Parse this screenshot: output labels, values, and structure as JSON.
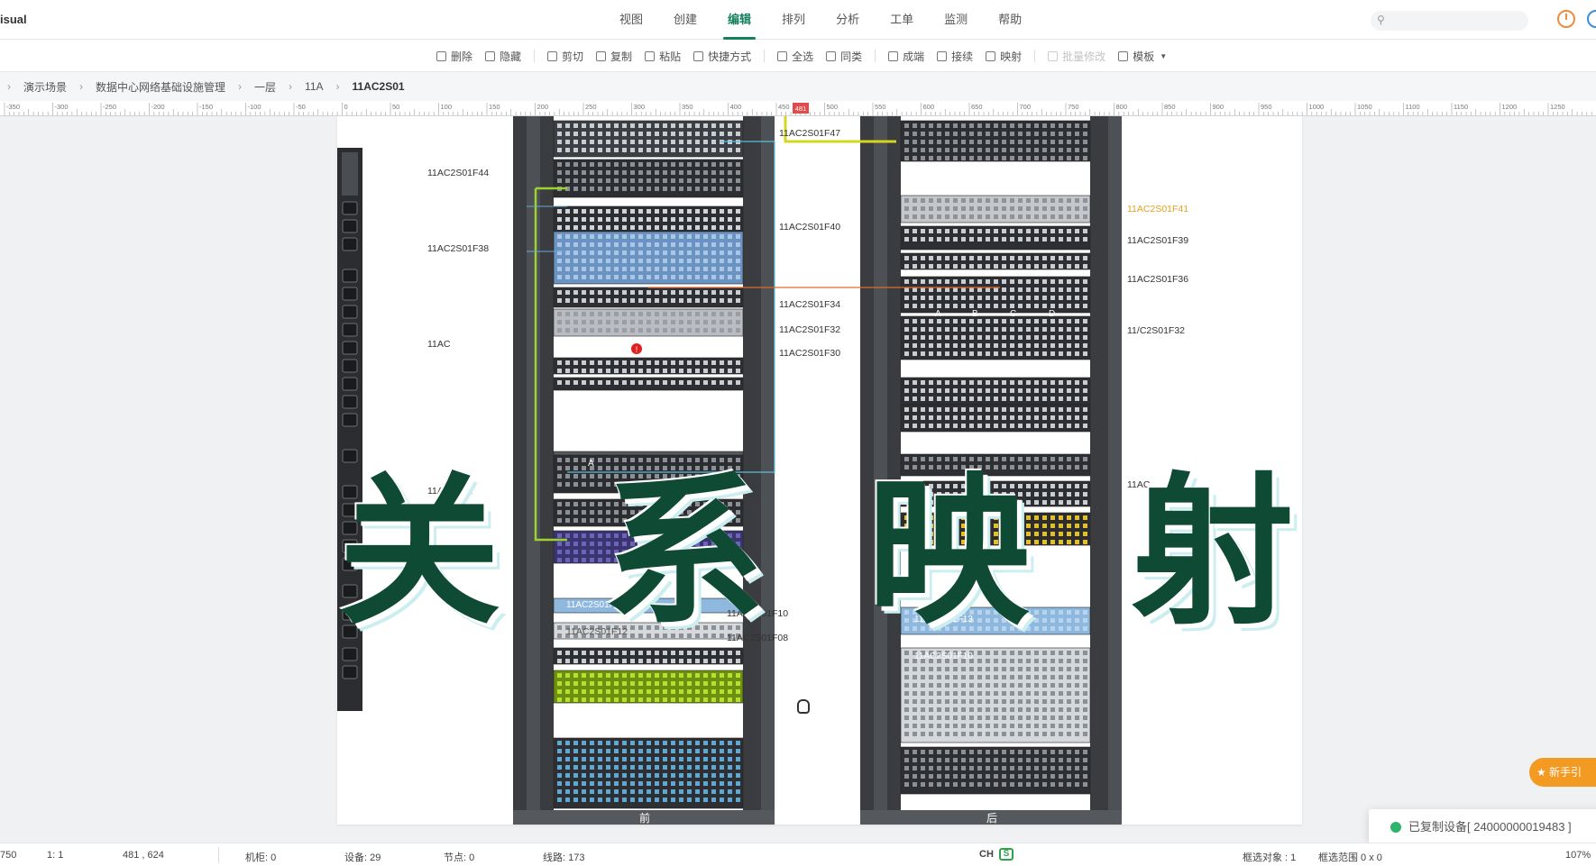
{
  "app": {
    "name": "isual"
  },
  "menu": [
    {
      "label": "视图"
    },
    {
      "label": "创建"
    },
    {
      "label": "编辑",
      "active": true
    },
    {
      "label": "排列"
    },
    {
      "label": "分析"
    },
    {
      "label": "工单"
    },
    {
      "label": "监测"
    },
    {
      "label": "帮助"
    }
  ],
  "toolbar": {
    "delete": "删除",
    "hide": "隐藏",
    "cut": "剪切",
    "copy": "复制",
    "paste": "粘贴",
    "shortcut": "快捷方式",
    "select_all": "全选",
    "same_type": "同类",
    "form": "成端",
    "connect": "接续",
    "map": "映射",
    "batch_edit": "批量修改",
    "template": "模板"
  },
  "breadcrumb": [
    "演示场景",
    "数据中心网络基础设施管理",
    "一层",
    "11A",
    "11AC2S01"
  ],
  "ruler": {
    "labels": [
      "-350",
      "-300",
      "-250",
      "-200",
      "-150",
      "-100",
      "-50",
      "0",
      "50",
      "100",
      "150",
      "200",
      "250",
      "300",
      "350",
      "400",
      "450",
      "500",
      "550",
      "600",
      "650",
      "700",
      "750",
      "800",
      "850",
      "900",
      "950",
      "1000",
      "1050",
      "1100",
      "1150",
      "1200",
      "1250"
    ],
    "marker": "481"
  },
  "rack_labels": {
    "left": [
      "11AC2S01F44",
      "11AC2S01F38",
      "11AC",
      "11AC2S01"
    ],
    "middle": [
      "11AC2S01F47",
      "11AC2S01F40",
      "11AC2S01F34",
      "11AC2S01F32",
      "11AC2S01F30",
      "11AC2S01F10",
      "11AC2S01F08"
    ],
    "right": [
      "11AC2S01F41",
      "11AC2S01F39",
      "11AC2S01F36",
      "11/C2S01F32",
      "11AC"
    ],
    "on_front": [
      "11AC2S01F14",
      "11AC2S01F12"
    ],
    "on_back": [
      "11AC2S01F13",
      "11AC2S01F10"
    ],
    "port_letters": [
      "A",
      "B",
      "C",
      "D"
    ],
    "slot_a": "A"
  },
  "racks": {
    "front": "前",
    "back": "后"
  },
  "overlay_title": [
    "关",
    "系",
    "映",
    "射"
  ],
  "guide_button": "新手引",
  "toast": "已复制设备[ 24000000019483 ]",
  "status": {
    "coord_x": "750",
    "scale": "1: 1",
    "mouse": "481 , 624",
    "cabinet": "机柜: 0",
    "device": "设备: 29",
    "node": "节点: 0",
    "line": "线路: 173",
    "ime": "CH",
    "ime_s": "S",
    "selected": "框选对象 : 1",
    "range": "框选范围 0 x 0",
    "zoom": "107%"
  },
  "colors": {
    "accent": "#14805e",
    "title": "#0f4a34",
    "orange": "#f39a22"
  }
}
